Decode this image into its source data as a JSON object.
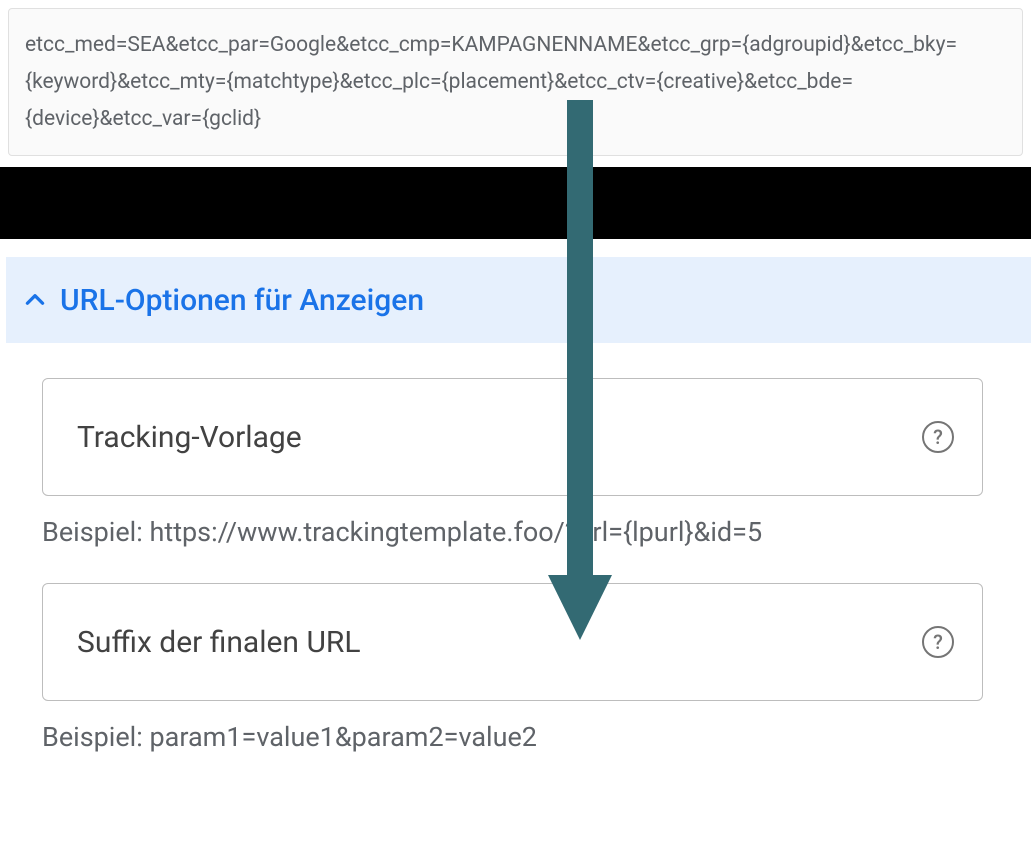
{
  "code_block": "etcc_med=SEA&etcc_par=Google&etcc_cmp=KAMPAGNENNAME&etcc_grp={adgroupid}&etcc_bky={keyword}&etcc_mty={matchtype}&etcc_plc={placement}&etcc_ctv={creative}&etcc_bde={device}&etcc_var={gclid}",
  "section": {
    "title": "URL-Optionen für Anzeigen"
  },
  "fields": {
    "tracking": {
      "label": "Tracking-Vorlage",
      "example": "Beispiel: https://www.trackingtemplate.foo/?url={lpurl}&id=5"
    },
    "suffix": {
      "label": "Suffix der finalen URL",
      "example": "Beispiel: param1=value1&param2=value2"
    }
  },
  "arrow_color": "#336a73"
}
